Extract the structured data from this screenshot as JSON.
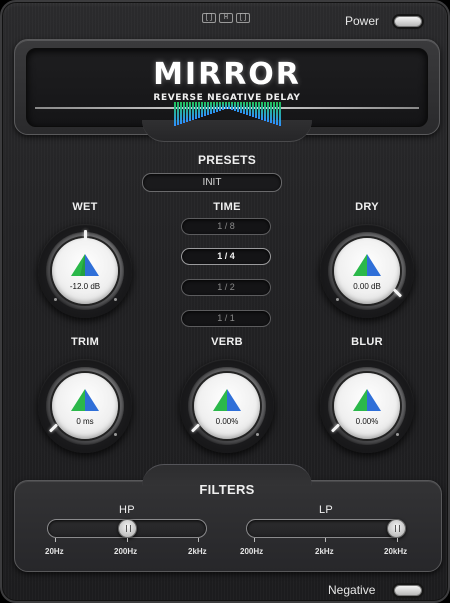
{
  "header": {
    "brand_icons": [
      "[]",
      "H",
      "[]"
    ],
    "power_label": "Power",
    "title": "MIRROR",
    "subtitle": "REVERSE NEGATIVE DELAY"
  },
  "presets": {
    "label": "PRESETS",
    "current": "INIT"
  },
  "time": {
    "label": "TIME",
    "options": [
      "1 / 8",
      "1 / 4",
      "1 / 2",
      "1 / 1"
    ],
    "selected": "1 / 4"
  },
  "knobs": {
    "wet": {
      "label": "WET",
      "value": "-12.0 dB"
    },
    "dry": {
      "label": "DRY",
      "value": "0.00 dB"
    },
    "trim": {
      "label": "TRIM",
      "value": "0 ms"
    },
    "verb": {
      "label": "VERB",
      "value": "0.00%"
    },
    "blur": {
      "label": "BLUR",
      "value": "0.00%"
    }
  },
  "filters": {
    "label": "FILTERS",
    "hp": {
      "label": "HP",
      "min": "20Hz",
      "mid": "200Hz",
      "max": "2kHz"
    },
    "lp": {
      "label": "LP",
      "min": "200Hz",
      "mid": "2kHz",
      "max": "20kHz"
    }
  },
  "footer": {
    "negative_label": "Negative"
  },
  "colors": {
    "accent_green": "#22c45a",
    "accent_blue": "#2f8fff",
    "panel": "#262628"
  }
}
